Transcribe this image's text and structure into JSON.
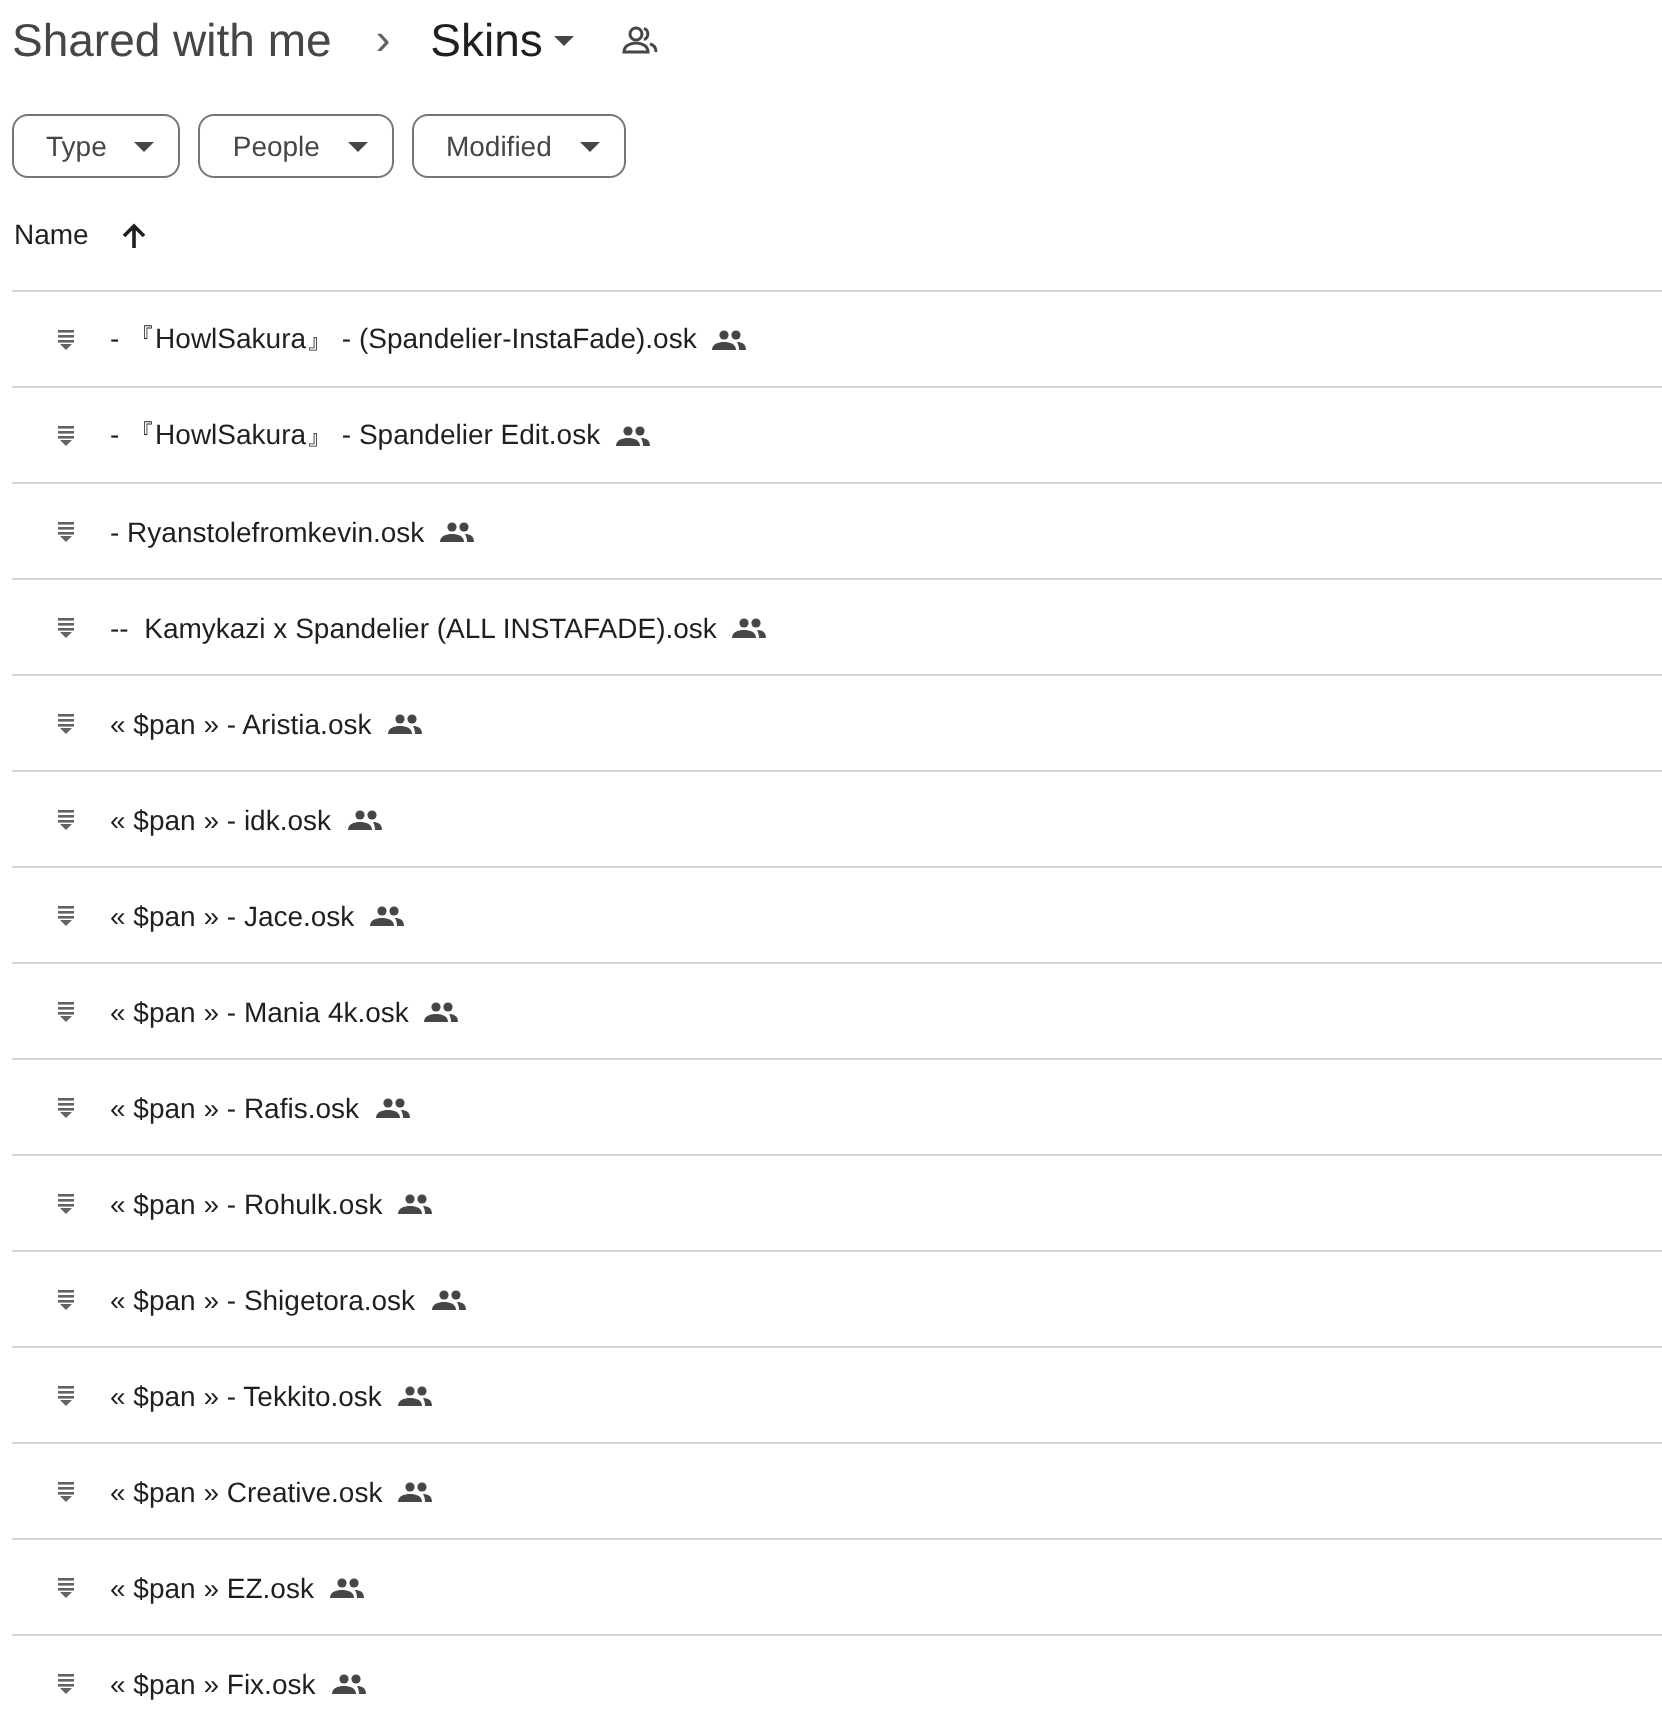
{
  "breadcrumb": {
    "parent": "Shared with me",
    "separator": "›",
    "current": "Skins"
  },
  "filters": [
    "Type",
    "People",
    "Modified"
  ],
  "table": {
    "columns": [
      {
        "label": "Name",
        "ascending": true
      }
    ],
    "rows": [
      {
        "name": "- 『HowlSakura』 - (Spandelier-InstaFade).osk",
        "shared": true
      },
      {
        "name": "- 『HowlSakura』 - Spandelier Edit.osk",
        "shared": true
      },
      {
        "name": "- Ryanstolefromkevin.osk",
        "shared": true
      },
      {
        "name": "--  Kamykazi x Spandelier (ALL INSTAFADE).osk",
        "shared": true
      },
      {
        "name": "« $pan » - Aristia.osk",
        "shared": true
      },
      {
        "name": "« $pan » - idk.osk",
        "shared": true
      },
      {
        "name": "« $pan » - Jace.osk",
        "shared": true
      },
      {
        "name": "« $pan » - Mania 4k.osk",
        "shared": true
      },
      {
        "name": "« $pan » - Rafis.osk",
        "shared": true
      },
      {
        "name": "« $pan » - Rohulk.osk",
        "shared": true
      },
      {
        "name": "« $pan » - Shigetora.osk",
        "shared": true
      },
      {
        "name": "« $pan » - Tekkito.osk",
        "shared": true
      },
      {
        "name": "« $pan » Creative.osk",
        "shared": true
      },
      {
        "name": "« $pan » EZ.osk",
        "shared": true
      },
      {
        "name": "« $pan » Fix.osk",
        "shared": true
      }
    ]
  }
}
